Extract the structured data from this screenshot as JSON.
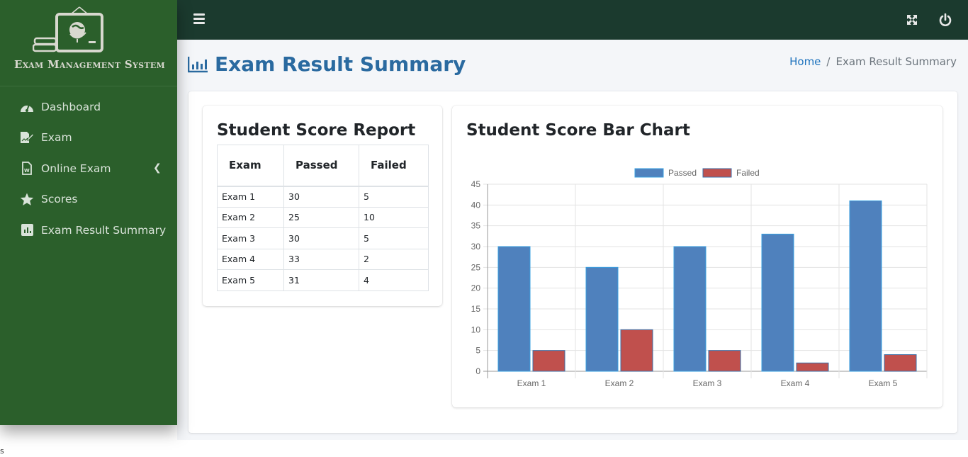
{
  "brand": {
    "name": "Exam Management System",
    "logo_icon": "classroom-board-icon"
  },
  "sidebar": {
    "items": [
      {
        "label": "Dashboard",
        "icon": "gauge-icon"
      },
      {
        "label": "Exam",
        "icon": "edit-document-icon"
      },
      {
        "label": "Online Exam",
        "icon": "word-file-icon",
        "has_submenu": true
      },
      {
        "label": "Scores",
        "icon": "star-icon"
      },
      {
        "label": "Exam Result Summary",
        "icon": "bar-chart-icon"
      }
    ]
  },
  "topbar": {
    "menu_icon": "hamburger-icon",
    "fullscreen_icon": "expand-icon",
    "logout_icon": "power-icon"
  },
  "header": {
    "title": "Exam Result Summary",
    "breadcrumb": {
      "home": "Home",
      "separator": "/",
      "current": "Exam Result Summary"
    }
  },
  "report": {
    "title": "Student Score Report",
    "columns": [
      "Exam",
      "Passed",
      "Failed"
    ],
    "rows": [
      [
        "Exam 1",
        "30",
        "5"
      ],
      [
        "Exam 2",
        "25",
        "10"
      ],
      [
        "Exam 3",
        "30",
        "5"
      ],
      [
        "Exam 4",
        "33",
        "2"
      ],
      [
        "Exam 5",
        "31",
        "4"
      ]
    ]
  },
  "colors": {
    "passed": "#4f81bd",
    "failed": "#c0504d",
    "sidebar": "#2b5f2b",
    "topbar": "#1b3a2e",
    "title": "#2a6aa0"
  },
  "chart_data": {
    "type": "bar",
    "title": "Student Score Bar Chart",
    "categories": [
      "Exam 1",
      "Exam 2",
      "Exam 3",
      "Exam 4",
      "Exam 5"
    ],
    "series": [
      {
        "name": "Passed",
        "values": [
          30,
          25,
          30,
          33,
          41
        ],
        "color": "#4f81bd"
      },
      {
        "name": "Failed",
        "values": [
          5,
          10,
          5,
          2,
          4
        ],
        "color": "#c0504d"
      }
    ],
    "yticks": [
      0,
      5,
      10,
      15,
      20,
      25,
      30,
      35,
      40,
      45
    ],
    "ylim": [
      0,
      45
    ],
    "xlabel": "",
    "ylabel": "",
    "grid": true,
    "legend": "top-center"
  },
  "footer": {
    "stray_text": "s"
  }
}
